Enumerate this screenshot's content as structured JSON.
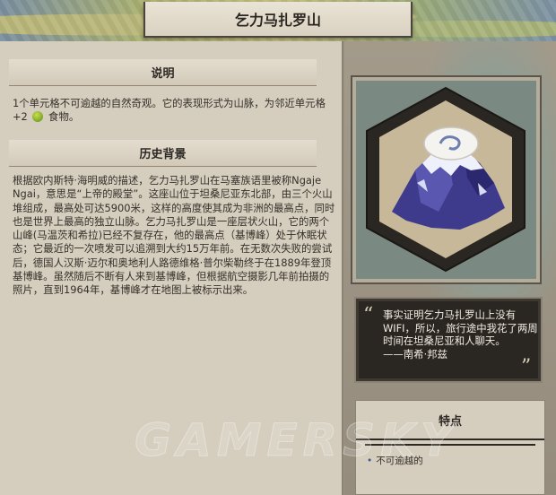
{
  "header": {
    "title": "乞力马扎罗山"
  },
  "description": {
    "heading": "说明",
    "text_before_icon": "1个单元格不可逾越的自然奇观。它的表现形式为山脉，为邻近单元格+2",
    "icon": "food-icon",
    "text_after_icon": "食物。"
  },
  "history": {
    "heading": "历史背景",
    "text": "根据欧内斯特·海明威的描述，乞力马扎罗山在马塞族语里被称Ngaje Ngai，意思是“上帝的殿堂”。这座山位于坦桑尼亚东北部，由三个火山堆组成，最高处可达5900米，这样的高度使其成为非洲的最高点，同时也是世界上最高的独立山脉。乞力马扎罗山是一座层状火山，它的两个山峰(马温茨和希拉)已经不复存在，他的最高点（基博峰）处于休眠状态；它最近的一次喷发可以追溯到大约15万年前。在无数次失败的尝试后，德国人汉斯·迈尔和奥地利人路德维格·普尔柴勒终于在1889年登顶基博峰。虽然随后不断有人来到基博峰，但根据航空摄影几年前拍摄的照片，直到1964年，基博峰才在地图上被标示出来。"
  },
  "portrait": {
    "icon": "snow-capped-mountain-icon"
  },
  "quote": {
    "open_mark": "“",
    "close_mark": "”",
    "text": "事实证明乞力马扎罗山上没有WIFI，所以，旅行途中我花了两周时间在坦桑尼亚和人聊天。",
    "author": "——南希·邦兹"
  },
  "traits": {
    "heading": "特点",
    "items": [
      "不可逾越的"
    ]
  },
  "watermark": {
    "text": "GAMERSKY"
  }
}
